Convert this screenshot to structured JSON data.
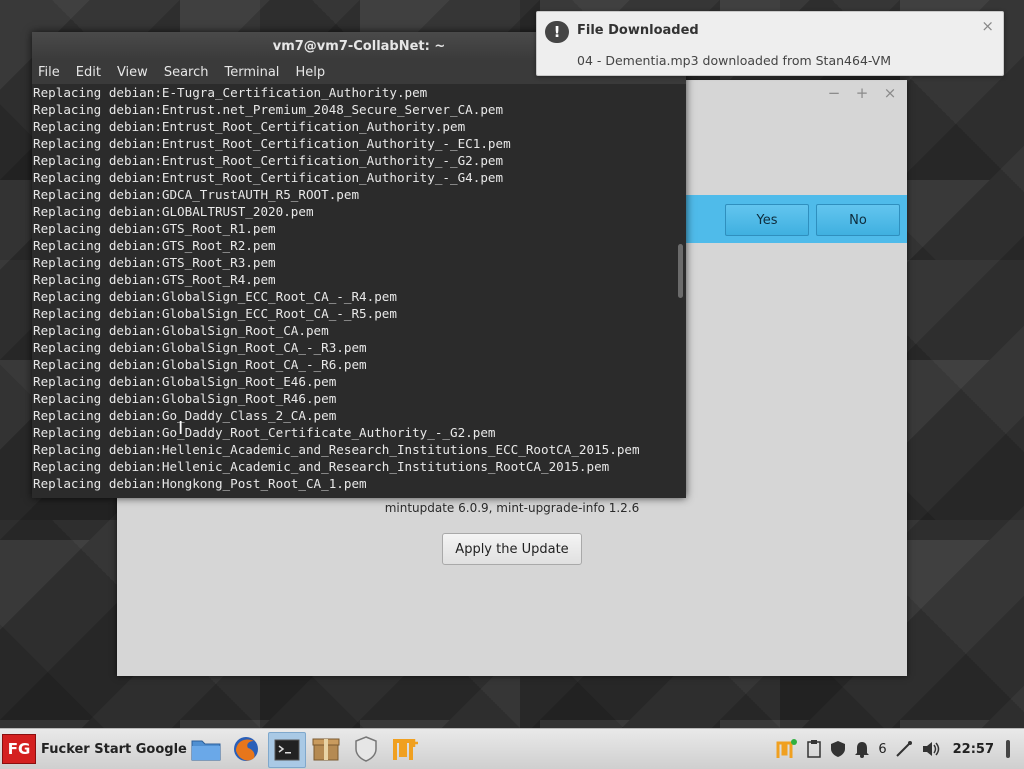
{
  "notification": {
    "title": "File Downloaded",
    "body": "04 - Dementia.mp3 downloaded from Stan464-VM",
    "close": "×"
  },
  "terminal": {
    "title": "vm7@vm7-CollabNet: ~",
    "menu": [
      "File",
      "Edit",
      "View",
      "Search",
      "Terminal",
      "Help"
    ],
    "lines": [
      "Replacing debian:E-Tugra_Certification_Authority.pem",
      "Replacing debian:Entrust.net_Premium_2048_Secure_Server_CA.pem",
      "Replacing debian:Entrust_Root_Certification_Authority.pem",
      "Replacing debian:Entrust_Root_Certification_Authority_-_EC1.pem",
      "Replacing debian:Entrust_Root_Certification_Authority_-_G2.pem",
      "Replacing debian:Entrust_Root_Certification_Authority_-_G4.pem",
      "Replacing debian:GDCA_TrustAUTH_R5_ROOT.pem",
      "Replacing debian:GLOBALTRUST_2020.pem",
      "Replacing debian:GTS_Root_R1.pem",
      "Replacing debian:GTS_Root_R2.pem",
      "Replacing debian:GTS_Root_R3.pem",
      "Replacing debian:GTS_Root_R4.pem",
      "Replacing debian:GlobalSign_ECC_Root_CA_-_R4.pem",
      "Replacing debian:GlobalSign_ECC_Root_CA_-_R5.pem",
      "Replacing debian:GlobalSign_Root_CA.pem",
      "Replacing debian:GlobalSign_Root_CA_-_R3.pem",
      "Replacing debian:GlobalSign_Root_CA_-_R6.pem",
      "Replacing debian:GlobalSign_Root_E46.pem",
      "Replacing debian:GlobalSign_Root_R46.pem",
      "Replacing debian:Go_Daddy_Class_2_CA.pem",
      "Replacing debian:Go_Daddy_Root_Certificate_Authority_-_G2.pem",
      "Replacing debian:Hellenic_Academic_and_Research_Institutions_ECC_RootCA_2015.pem",
      "Replacing debian:Hellenic_Academic_and_Research_Institutions_RootCA_2015.pem",
      "Replacing debian:Hongkong_Post_Root_CA_1.pem"
    ]
  },
  "update_window": {
    "controls": {
      "minimize": "−",
      "maximize": "+",
      "close": "×"
    },
    "yes_label": "Yes",
    "no_label": "No",
    "version_text": "mintupdate 6.0.9, mint-upgrade-info 1.2.6",
    "apply_label": "Apply the Update",
    "info_bar_color": "#4fbbea"
  },
  "taskbar": {
    "start_logo": "FG",
    "start_label": "Fucker Start Google",
    "apps": [
      "folder-icon",
      "firefox-icon",
      "terminal-icon",
      "archive-icon",
      "shield-icon",
      "mintupdate-icon"
    ],
    "tray": {
      "notification_count": "6",
      "clock": "22:57"
    }
  }
}
